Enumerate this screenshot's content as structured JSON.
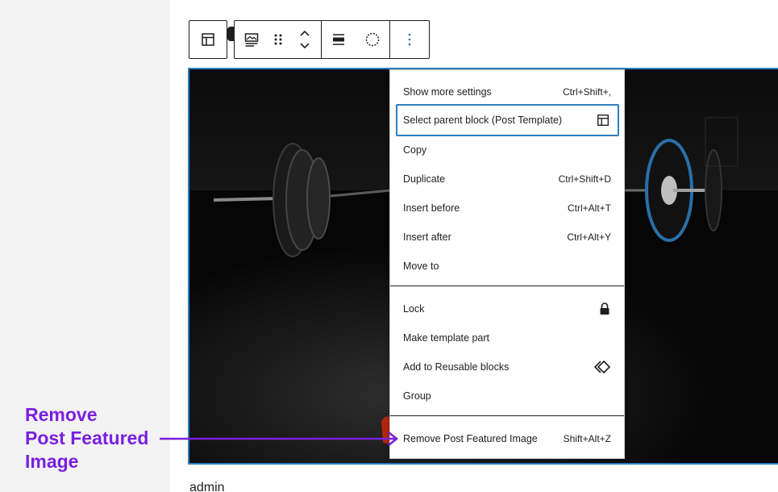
{
  "toolbar": {
    "parent_icon": "post-template-icon",
    "block_icon": "post-featured-image-icon",
    "drag_icon": "drag-handle-icon",
    "move_icon": "move-up-down-icon",
    "align_icon": "align-icon",
    "duotone_icon": "duotone-icon",
    "options_icon": "more-options-icon"
  },
  "menu": {
    "section1": [
      {
        "label": "Show more settings",
        "shortcut": "Ctrl+Shift+,"
      },
      {
        "label": "Select parent block (Post Template)",
        "shortcut": "",
        "icon": "post-template-icon"
      },
      {
        "label": "Copy",
        "shortcut": ""
      },
      {
        "label": "Duplicate",
        "shortcut": "Ctrl+Shift+D"
      },
      {
        "label": "Insert before",
        "shortcut": "Ctrl+Alt+T"
      },
      {
        "label": "Insert after",
        "shortcut": "Ctrl+Alt+Y"
      },
      {
        "label": "Move to",
        "shortcut": ""
      }
    ],
    "section2": [
      {
        "label": "Lock",
        "icon": "lock-icon"
      },
      {
        "label": "Make template part"
      },
      {
        "label": "Add to Reusable blocks",
        "icon": "reusable-block-icon"
      },
      {
        "label": "Group"
      }
    ],
    "section3": [
      {
        "label": "Remove Post Featured Image",
        "shortcut": "Shift+Alt+Z"
      }
    ]
  },
  "annotation": {
    "line1": "Remove",
    "line2": "Post Featured",
    "line3": "Image",
    "color": "#7a1fe0"
  },
  "below_text": "admin",
  "accent_color": "#2f7fc1"
}
